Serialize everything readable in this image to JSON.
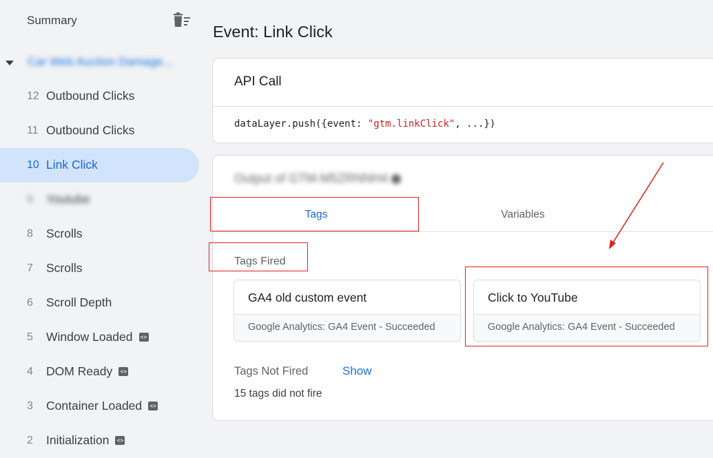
{
  "sidebar": {
    "title": "Summary",
    "container_name": "Car Web Auction Damage...",
    "events": [
      {
        "num": "12",
        "label": "Outbound Clicks",
        "active": false,
        "blurred": false,
        "badge": false
      },
      {
        "num": "11",
        "label": "Outbound Clicks",
        "active": false,
        "blurred": false,
        "badge": false
      },
      {
        "num": "10",
        "label": "Link Click",
        "active": true,
        "blurred": false,
        "badge": false
      },
      {
        "num": "9",
        "label": "Youtube",
        "active": false,
        "blurred": true,
        "badge": false
      },
      {
        "num": "8",
        "label": "Scrolls",
        "active": false,
        "blurred": false,
        "badge": false
      },
      {
        "num": "7",
        "label": "Scrolls",
        "active": false,
        "blurred": false,
        "badge": false
      },
      {
        "num": "6",
        "label": "Scroll Depth",
        "active": false,
        "blurred": false,
        "badge": false
      },
      {
        "num": "5",
        "label": "Window Loaded",
        "active": false,
        "blurred": false,
        "badge": true
      },
      {
        "num": "4",
        "label": "DOM Ready",
        "active": false,
        "blurred": false,
        "badge": true
      },
      {
        "num": "3",
        "label": "Container Loaded",
        "active": false,
        "blurred": false,
        "badge": true
      },
      {
        "num": "2",
        "label": "Initialization",
        "active": false,
        "blurred": false,
        "badge": true
      }
    ]
  },
  "main": {
    "title": "Event: Link Click",
    "api_call": {
      "header": "API Call",
      "code_prefix": "dataLayer.push({event: ",
      "code_string": "\"gtm.linkClick\"",
      "code_suffix": ", ...})"
    },
    "output": {
      "header": "Output of GTM-M5ZRNNH4",
      "tabs": [
        "Tags",
        "Variables"
      ],
      "tags_fired_label": "Tags Fired",
      "tags": [
        {
          "name": "GA4 old custom event",
          "status": "Google Analytics: GA4 Event - Succeeded"
        },
        {
          "name": "Click to YouTube",
          "status": "Google Analytics: GA4 Event - Succeeded"
        }
      ],
      "not_fired_label": "Tags Not Fired",
      "show_label": "Show",
      "not_fired_count": "15 tags did not fire"
    }
  },
  "colors": {
    "accent": "#1a73e8",
    "active_bg": "#d2e3fc",
    "annotation": "#e0201b"
  }
}
